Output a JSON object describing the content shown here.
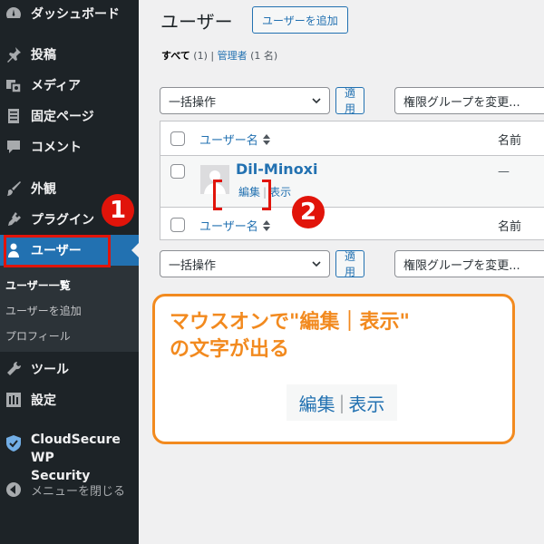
{
  "sidebar": {
    "items": [
      {
        "label": "ダッシュボード",
        "icon": "dashboard-icon"
      },
      {
        "label": "投稿",
        "icon": "pin-icon"
      },
      {
        "label": "メディア",
        "icon": "media-icon"
      },
      {
        "label": "固定ページ",
        "icon": "page-icon"
      },
      {
        "label": "コメント",
        "icon": "comment-icon"
      },
      {
        "label": "外観",
        "icon": "brush-icon"
      },
      {
        "label": "プラグイン",
        "icon": "plugin-icon"
      },
      {
        "label": "ユーザー",
        "icon": "user-icon"
      },
      {
        "label": "ツール",
        "icon": "wrench-icon"
      },
      {
        "label": "設定",
        "icon": "settings-icon"
      },
      {
        "label_line1": "CloudSecure WP",
        "label_line2": "Security",
        "icon": "shield-check-icon"
      },
      {
        "label": "メニューを閉じる",
        "icon": "collapse-icon"
      }
    ],
    "submenu": [
      "ユーザー一覧",
      "ユーザーを追加",
      "プロフィール"
    ]
  },
  "main": {
    "title": "ユーザー",
    "add_button": "ユーザーを追加",
    "filter": {
      "all_label": "すべて",
      "all_count": "(1)",
      "separator": "|",
      "admin_label": "管理者",
      "admin_count": "(1 名)"
    },
    "bulk_select": "一括操作",
    "apply_button": "適用",
    "role_select": "権限グループを変更...",
    "table": {
      "col_username": "ユーザー名",
      "col_name": "名前",
      "row": {
        "username": "Dil-Minoxi",
        "name": "—",
        "edit": "編集",
        "view": "表示",
        "separator": "|"
      }
    }
  },
  "annotations": {
    "badge1": "1",
    "badge2": "2",
    "callout_line1": "マウスオンで\"編集｜表示\"",
    "callout_line2": "の文字が出る",
    "sample_edit": "編集",
    "sample_separator": "|",
    "sample_view": "表示"
  },
  "colors": {
    "sidebar_bg": "#1d2327",
    "accent": "#2271b1",
    "annotation_red": "#e1140a",
    "callout_orange": "#f28a1f"
  }
}
